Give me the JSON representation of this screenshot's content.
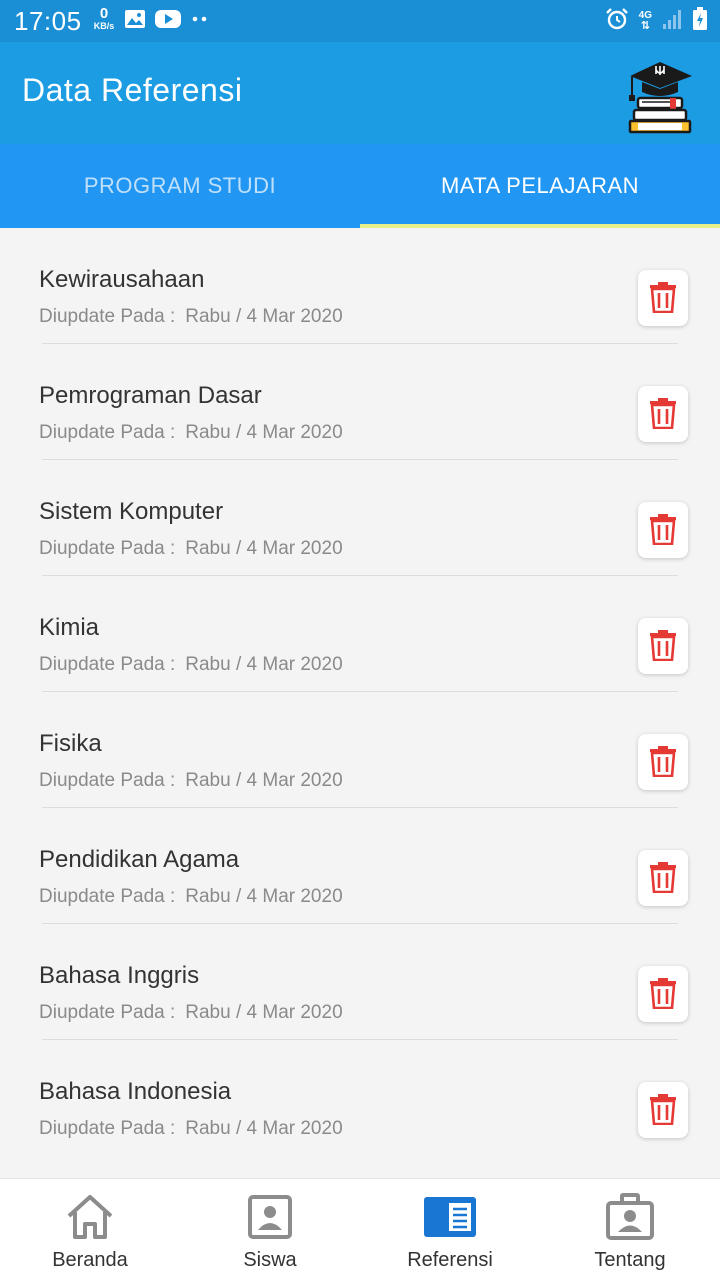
{
  "status_bar": {
    "time": "17:05",
    "net_speed_value": "0",
    "net_speed_unit": "KB/s",
    "network_label": "4G",
    "icons": [
      "image-icon",
      "youtube-icon",
      "more-dots-icon",
      "alarm-icon",
      "signal-icon",
      "battery-icon"
    ]
  },
  "app_bar": {
    "title": "Data Referensi",
    "logo_icon": "graduation-cap-books-icon"
  },
  "tabs": [
    {
      "label": "PROGRAM STUDI",
      "active": false
    },
    {
      "label": "MATA PELAJARAN",
      "active": true
    }
  ],
  "list": {
    "items": [
      {
        "name": "Kewirausahaan",
        "updated_label": "Diupdate Pada :",
        "updated_value": "Rabu / 4 Mar 2020"
      },
      {
        "name": "Pemrograman Dasar",
        "updated_label": "Diupdate Pada :",
        "updated_value": "Rabu / 4 Mar 2020"
      },
      {
        "name": "Sistem Komputer",
        "updated_label": "Diupdate Pada :",
        "updated_value": "Rabu / 4 Mar 2020"
      },
      {
        "name": "Kimia",
        "updated_label": "Diupdate Pada :",
        "updated_value": "Rabu / 4 Mar 2020"
      },
      {
        "name": "Fisika",
        "updated_label": "Diupdate Pada :",
        "updated_value": "Rabu / 4 Mar 2020"
      },
      {
        "name": "Pendidikan Agama",
        "updated_label": "Diupdate Pada :",
        "updated_value": "Rabu / 4 Mar 2020"
      },
      {
        "name": "Bahasa Inggris",
        "updated_label": "Diupdate Pada :",
        "updated_value": "Rabu / 4 Mar 2020"
      },
      {
        "name": "Bahasa Indonesia",
        "updated_label": "Diupdate Pada :",
        "updated_value": "Rabu / 4 Mar 2020"
      }
    ],
    "delete_icon": "trash-icon"
  },
  "bottom_nav": {
    "items": [
      {
        "label": "Beranda",
        "icon": "home-icon",
        "active": false
      },
      {
        "label": "Siswa",
        "icon": "student-icon",
        "active": false
      },
      {
        "label": "Referensi",
        "icon": "reference-book-icon",
        "active": true
      },
      {
        "label": "Tentang",
        "icon": "about-briefcase-icon",
        "active": false
      }
    ]
  },
  "colors": {
    "status_bar": "#1a8fd6",
    "app_bar": "#1c9de3",
    "tab_bar": "#2196f3",
    "tab_indicator": "#e8f08c",
    "delete_icon": "#e53935",
    "nav_active": "#1976d2",
    "nav_inactive": "#8c8c8c"
  }
}
